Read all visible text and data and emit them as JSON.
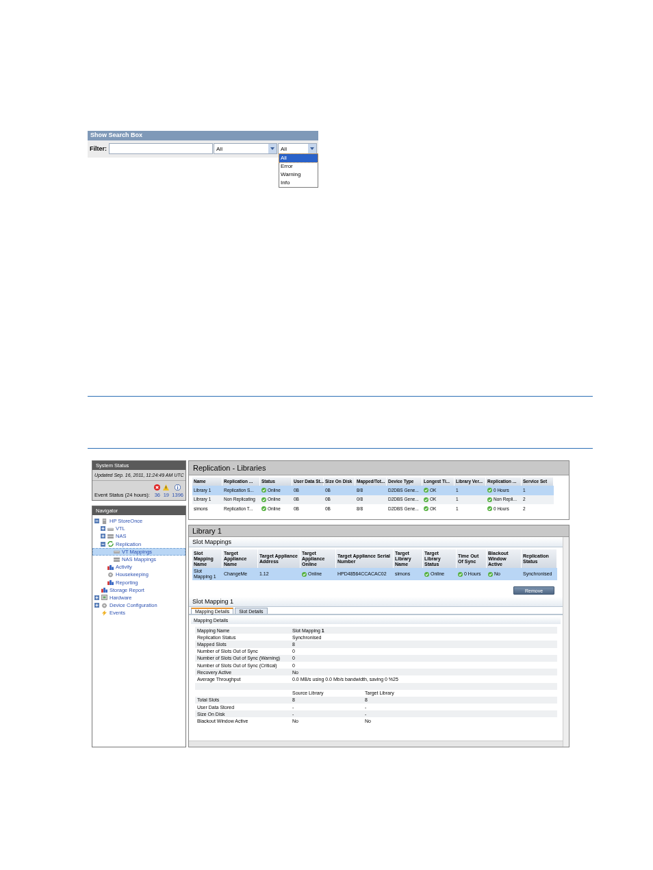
{
  "search_box": {
    "title": "Show Search Box",
    "filter_label": "Filter:",
    "select_1": {
      "value": "All"
    },
    "select_2": {
      "value": "All",
      "expanded": true,
      "options": [
        {
          "label": "All",
          "selected": true
        },
        {
          "label": "Error",
          "selected": false
        },
        {
          "label": "Warning",
          "selected": false
        },
        {
          "label": "Info",
          "selected": false
        }
      ]
    }
  },
  "app": {
    "system_status": {
      "title": "System Status",
      "updated": "Updated Sep. 16, 2011, 11:24:49 AM UTC",
      "event_label": "Event Status (24 hours):",
      "counts": [
        {
          "kind": "error",
          "value": "36"
        },
        {
          "kind": "warning",
          "value": "19"
        },
        {
          "kind": "info",
          "value": "1396"
        }
      ]
    },
    "navigator": {
      "title": "Navigator",
      "items": [
        {
          "label": "HP StoreOnce",
          "kind": "storage",
          "expanded": true,
          "selected": false,
          "children": [
            {
              "label": "VTL",
              "kind": "drive",
              "expanded": false,
              "selected": false
            },
            {
              "label": "NAS",
              "kind": "nas",
              "expanded": false,
              "selected": false
            },
            {
              "label": "Replication",
              "kind": "sync",
              "expanded": true,
              "selected": false,
              "children": [
                {
                  "label": "VT Mappings",
                  "kind": "drive",
                  "selected": true
                },
                {
                  "label": "NAS Mappings",
                  "kind": "nas",
                  "selected": false
                }
              ]
            },
            {
              "label": "Activity",
              "kind": "chart",
              "selected": false
            },
            {
              "label": "Housekeeping",
              "kind": "gear",
              "selected": false
            },
            {
              "label": "Reporting",
              "kind": "chart",
              "selected": false
            }
          ]
        },
        {
          "label": "Storage Report",
          "kind": "chart",
          "selected": false
        },
        {
          "label": "Hardware",
          "kind": "hardware",
          "expanded": false,
          "selected": false
        },
        {
          "label": "Device Configuration",
          "kind": "gear",
          "expanded": false,
          "selected": false
        },
        {
          "label": "Events",
          "kind": "bolt",
          "selected": false
        }
      ]
    },
    "libraries": {
      "title": "Replication - Libraries",
      "columns": [
        {
          "label": "Name",
          "kind": "text"
        },
        {
          "label": "Replication ...",
          "kind": "text"
        },
        {
          "label": "Status",
          "kind": "status"
        },
        {
          "label": "User Data St...",
          "kind": "text"
        },
        {
          "label": "Size On Disk",
          "kind": "text"
        },
        {
          "label": "Mapped/Tot...",
          "kind": "text"
        },
        {
          "label": "Device Type",
          "kind": "text"
        },
        {
          "label": "Longest Ti...",
          "kind": "status"
        },
        {
          "label": "Library Ver...",
          "kind": "text"
        },
        {
          "label": "Replication ...",
          "kind": "status"
        },
        {
          "label": "Service Set",
          "kind": "text"
        }
      ],
      "rows": [
        {
          "selected": true,
          "cells": [
            "Library 1",
            "Replication S...",
            "Online",
            "0B",
            "0B",
            "8/8",
            "D2DBS Gene...",
            "OK",
            "1",
            "0 Hours",
            "1"
          ]
        },
        {
          "selected": false,
          "cells": [
            "Library 1",
            "Non Replicating",
            "Online",
            "0B",
            "0B",
            "0/8",
            "D2DBS Gene...",
            "OK",
            "1",
            "Non Repli...",
            "2"
          ]
        },
        {
          "selected": false,
          "cells": [
            "simons",
            "Replication T...",
            "Online",
            "0B",
            "0B",
            "8/8",
            "D2DBS Gene...",
            "OK",
            "1",
            "0 Hours",
            "2"
          ]
        }
      ]
    },
    "library": {
      "title": "Library 1",
      "slot_mappings": {
        "title": "Slot Mappings",
        "columns": [
          {
            "label": "Slot Mapping Name",
            "kind": "text"
          },
          {
            "label": "Target Appliance Name",
            "kind": "text"
          },
          {
            "label": "Target Appliance Address",
            "kind": "text"
          },
          {
            "label": "Target Appliance Online",
            "kind": "status"
          },
          {
            "label": "Target Appliance Serial Number",
            "kind": "text"
          },
          {
            "label": "Target Library Name",
            "kind": "text"
          },
          {
            "label": "Target Library Status",
            "kind": "status"
          },
          {
            "label": "Time Out Of Sync",
            "kind": "status"
          },
          {
            "label": "Blackout Window Active",
            "kind": "status"
          },
          {
            "label": "Replication Status",
            "kind": "text"
          }
        ],
        "rows": [
          {
            "selected": true,
            "cells": [
              "Slot Mapping 1",
              "ChangeMe",
              "1.12",
              "Online",
              "HPD48564CCACAC02",
              "simons",
              "Online",
              "0 Hours",
              "No",
              "Synchronised"
            ]
          }
        ],
        "remove_button": "Remove"
      },
      "slot_mapping": {
        "title": "Slot Mapping 1",
        "tabs": [
          {
            "label": "Mapping Details",
            "selected": true
          },
          {
            "label": "Slot Details",
            "selected": false
          }
        ],
        "section": "Mapping Details",
        "rows": [
          {
            "kind": "pair",
            "label": "Mapping Name",
            "value": "Slot Mapping **1**"
          },
          {
            "kind": "pair",
            "label": "Replication Status",
            "value": "Synchronised"
          },
          {
            "kind": "pair",
            "label": "Mapped Slots",
            "value": "8"
          },
          {
            "kind": "pair",
            "label": "Number of Slots Out of Sync",
            "value": "0"
          },
          {
            "kind": "pair",
            "label": "Number of Slots Out of Sync (Warning)",
            "value": "0"
          },
          {
            "kind": "pair",
            "label": "Number of Slots Out of Sync (Critical)",
            "value": "0"
          },
          {
            "kind": "pair",
            "label": "Recovery Active",
            "value": "No"
          },
          {
            "kind": "pair",
            "label": "Average Throughput",
            "value": "0.0 MB/s using 0.0 Mb/s bandwidth, saving 0 %25"
          },
          {
            "kind": "blank"
          },
          {
            "kind": "subhead",
            "value": "Source Library",
            "value2": "Target Library"
          },
          {
            "kind": "pair",
            "label": "Total Slots",
            "value": "8",
            "value2": "8"
          },
          {
            "kind": "pair",
            "label": "User Data Stored",
            "value": "-",
            "value2": "-"
          },
          {
            "kind": "pair",
            "label": "Size On Disk",
            "value": "-",
            "value2": "-"
          },
          {
            "kind": "pair",
            "label": "Blackout Window Active",
            "value": "No",
            "value2": "No"
          }
        ]
      }
    }
  }
}
